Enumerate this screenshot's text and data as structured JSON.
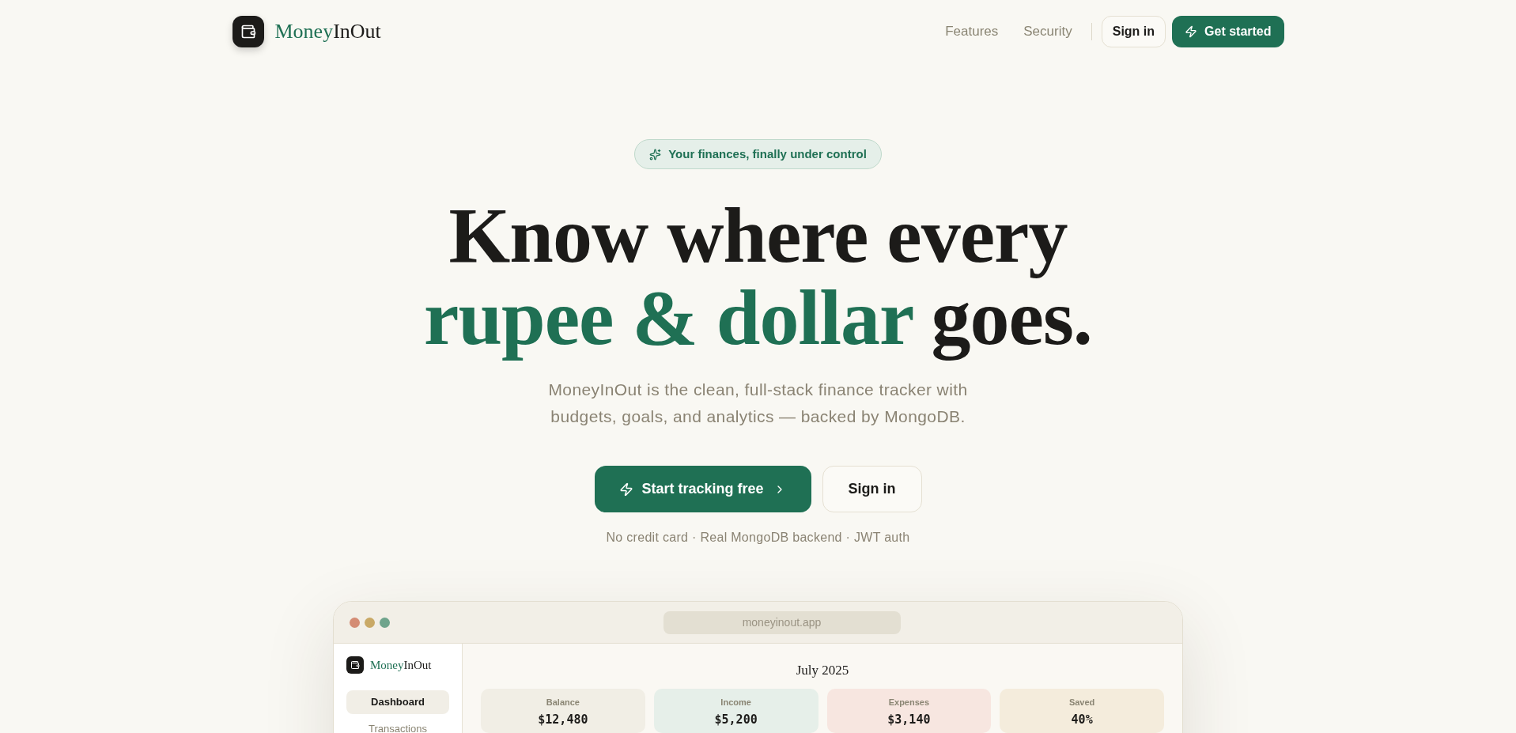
{
  "header": {
    "logo": {
      "lead": "Money",
      "rest": "InOut"
    },
    "nav": [
      {
        "label": "Features"
      },
      {
        "label": "Security"
      }
    ],
    "sign_in": "Sign in",
    "get_started": "Get started"
  },
  "hero": {
    "badge": "Your finances, finally under control",
    "headline": {
      "line_1": "Know where every",
      "highlight": "rupee & dollar",
      "rest": "goes."
    },
    "subtitle": "MoneyInOut is the clean, full-stack finance tracker with budgets, goals, and analytics — backed by MongoDB.",
    "primary_button": "Start tracking free",
    "secondary_button": "Sign in",
    "note": "No credit card · Real MongoDB backend · JWT auth"
  },
  "preview": {
    "url": "moneyinout.app",
    "logo": {
      "lead": "Money",
      "rest": "InOut"
    },
    "sidebar": [
      {
        "label": "Dashboard",
        "selected": true
      },
      {
        "label": "Transactions",
        "selected": false
      }
    ],
    "month": "July 2025",
    "stats": [
      {
        "label": "Balance",
        "value": "$12,480",
        "color": "#f1eee5"
      },
      {
        "label": "Income",
        "value": "$5,200",
        "color": "#e6efe9"
      },
      {
        "label": "Expenses",
        "value": "$3,140",
        "color": "#f7e6e0"
      },
      {
        "label": "Saved",
        "value": "40%",
        "color": "#f4ecdc"
      }
    ]
  }
}
